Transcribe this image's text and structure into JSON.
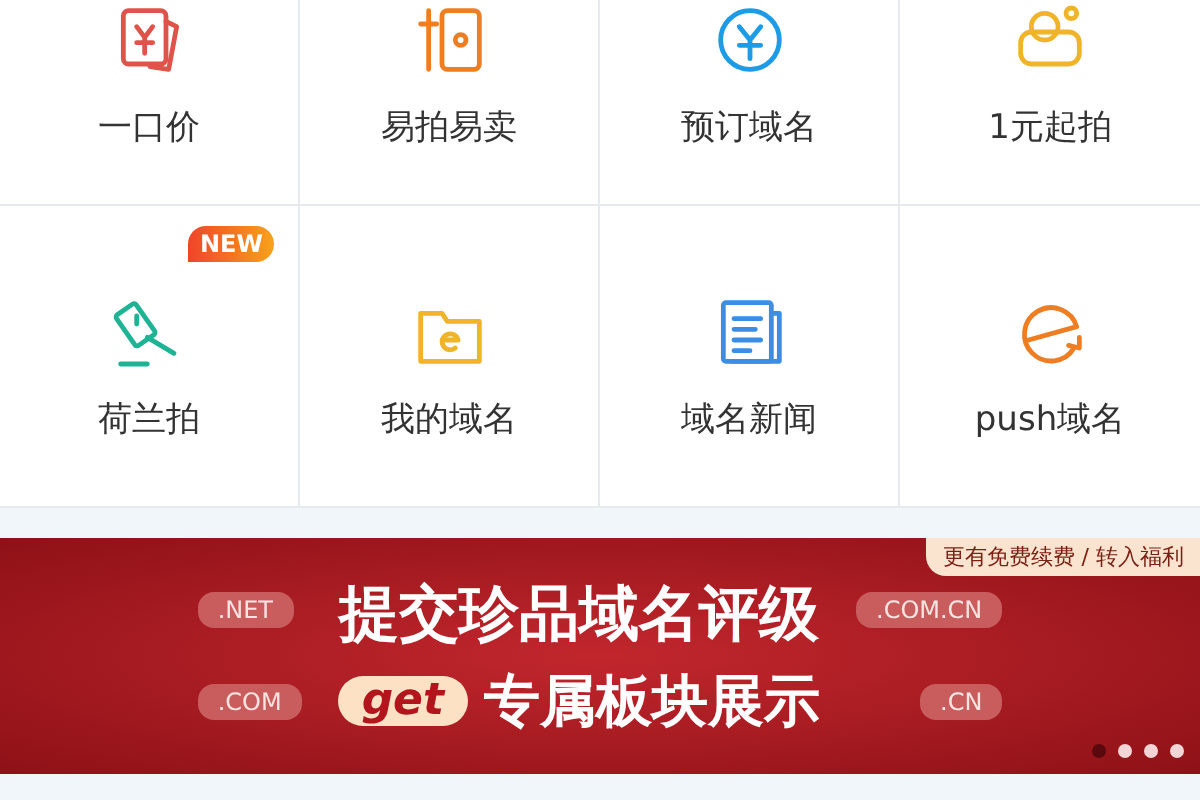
{
  "grid": [
    {
      "label": "一口价"
    },
    {
      "label": "易拍易卖"
    },
    {
      "label": "预订域名"
    },
    {
      "label": "1元起拍"
    },
    {
      "label": "荷兰拍",
      "badge": "NEW"
    },
    {
      "label": "我的域名"
    },
    {
      "label": "域名新闻"
    },
    {
      "label": "push域名"
    }
  ],
  "banner": {
    "corner_note": "更有免费续费 / 转入福利",
    "headline": "提交**珍品域名**评级",
    "get_tag": "get",
    "subline": "专属板块展示",
    "left_tags": [
      ".NET",
      ".COM"
    ],
    "right_tags": [
      ".COM.CN",
      ".CN"
    ],
    "dots": [
      {
        "selected": true
      },
      {
        "selected": false
      },
      {
        "selected": false
      },
      {
        "selected": false
      }
    ]
  }
}
